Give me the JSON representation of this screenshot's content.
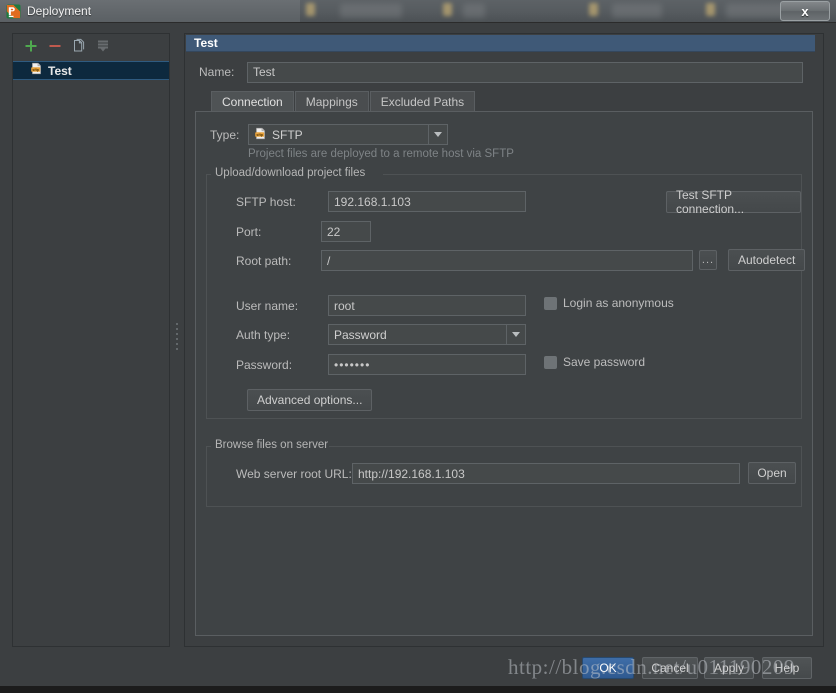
{
  "window": {
    "title": "Deployment",
    "app_icon": "pycharm-icon",
    "close_label": "x"
  },
  "sidebar": {
    "toolbar": [
      {
        "name": "add-icon",
        "glyph": "+"
      },
      {
        "name": "remove-icon",
        "glyph": "-"
      },
      {
        "name": "copy-icon",
        "glyph": "copy"
      },
      {
        "name": "set-default-icon",
        "glyph": "default"
      }
    ],
    "items": [
      {
        "label": "Test",
        "icon": "sftp-icon",
        "selected": true
      }
    ]
  },
  "details": {
    "header_title": "Test",
    "name_label": "Name:",
    "name_value": "Test",
    "tabs": [
      {
        "label": "Connection",
        "active": true
      },
      {
        "label": "Mappings",
        "active": false
      },
      {
        "label": "Excluded Paths",
        "active": false
      }
    ],
    "type_label": "Type:",
    "type_value": "SFTP",
    "type_icon": "sftp-icon",
    "type_hint": "Project files are deployed to a remote host via SFTP",
    "upload_group_title": "Upload/download project files",
    "sftp_host_label": "SFTP host:",
    "sftp_host_value": "192.168.1.103",
    "test_connection_label": "Test SFTP connection...",
    "port_label": "Port:",
    "port_value": "22",
    "root_path_label": "Root path:",
    "root_path_value": "/",
    "root_path_browse_label": "...",
    "autodetect_label": "Autodetect",
    "user_name_label": "User name:",
    "user_name_value": "root",
    "login_anonymous_label": "Login as anonymous",
    "login_anonymous_checked": false,
    "auth_type_label": "Auth type:",
    "auth_type_value": "Password",
    "password_label": "Password:",
    "password_value": "•••••••",
    "save_password_label": "Save password",
    "save_password_checked": false,
    "advanced_options_label": "Advanced options...",
    "browse_group_title": "Browse files on server",
    "web_root_label": "Web server root URL:",
    "web_root_value": "http://192.168.1.103",
    "open_label": "Open"
  },
  "footer": {
    "ok_label": "OK",
    "cancel_label": "Cancel",
    "apply_label": "Apply",
    "help_label": "Help"
  },
  "watermark": {
    "text": "http://blog.csdn.net/u011190209"
  },
  "colors": {
    "dialog_bg": "#3c3f41",
    "panel_bg": "#3f4345",
    "field_bg": "#45494a",
    "selection_blue": "#0d293e",
    "header_blue": "#3f5977",
    "accent_ok": "#3f6ea8",
    "text": "#bbbbbb",
    "add_green": "#5aa85a",
    "remove_red": "#c05a4e"
  }
}
